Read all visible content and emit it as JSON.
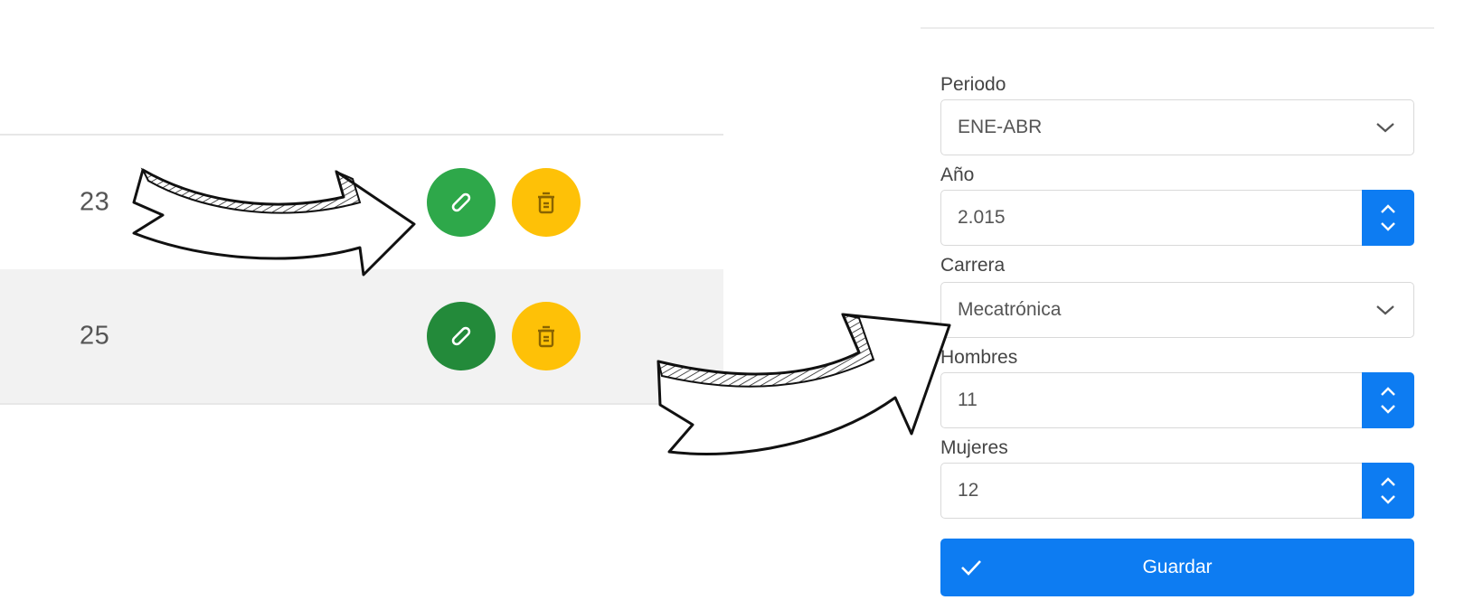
{
  "table": {
    "rows": [
      {
        "value": "23",
        "edit_icon": "pencil-icon",
        "delete_icon": "trash-icon"
      },
      {
        "value": "25",
        "edit_icon": "pencil-icon",
        "delete_icon": "trash-icon"
      }
    ]
  },
  "form": {
    "periodo": {
      "label": "Periodo",
      "value": "ENE-ABR"
    },
    "anio": {
      "label": "Año",
      "value": "2.015"
    },
    "carrera": {
      "label": "Carrera",
      "value": "Mecatrónica"
    },
    "hombres": {
      "label": "Hombres",
      "value": "11"
    },
    "mujeres": {
      "label": "Mujeres",
      "value": "12"
    },
    "save_label": "Guardar"
  },
  "colors": {
    "edit": "#2ea84a",
    "edit_active": "#238a3a",
    "delete": "#fec107",
    "primary": "#0d7cf2",
    "row_alt": "#f2f2f2"
  }
}
